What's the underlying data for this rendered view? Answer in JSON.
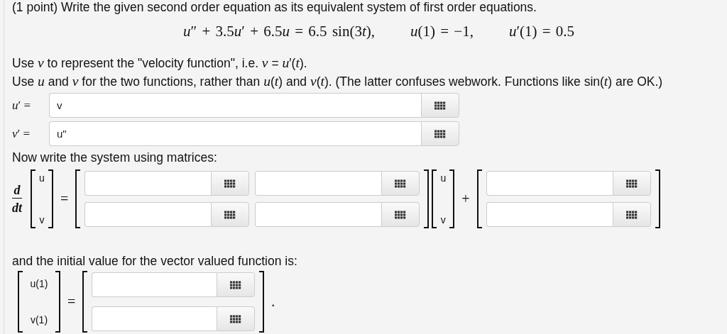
{
  "problem": {
    "intro": "(1 point) Write the given second order equation as its equivalent system of first order equations.",
    "equation": [
      "u″ + 3.5u′ + 6.5u = 6.5 sin(3t),",
      "u(1) = −1,",
      "u′(1) = 0.5"
    ],
    "notes": [
      "Use *v* to represent the \"velocity function\", i.e. *v* = *u*′(*t*).",
      "Use *u* and *v* for the two functions, rather than *u*(*t*) and *v*(*t*). (The latter confuses webwork. Functions like sin(*t*) are OK.)"
    ],
    "first_order": [
      {
        "label": "*u*′ =",
        "value": "v"
      },
      {
        "label": "*v*′ =",
        "value": "u\""
      }
    ],
    "matrix_prompt": "Now write the system using matrices:",
    "derivative": {
      "numerator": "d",
      "denominator": "dt"
    },
    "lhs_vector": [
      "u",
      "v"
    ],
    "equals": "=",
    "coefficient_matrix": [
      [
        {
          "kind": "field"
        },
        {
          "kind": "field"
        }
      ],
      [
        {
          "kind": "field"
        },
        {
          "kind": "field"
        }
      ]
    ],
    "state_vector": [
      "u",
      "v"
    ],
    "plus": "+",
    "forcing_vector": [
      {
        "kind": "field"
      },
      {
        "kind": "field"
      }
    ],
    "initial_prompt": "and the initial value for the vector valued function is:",
    "initial_lhs": [
      "u(1)",
      "v(1)"
    ],
    "initial_equals": "=",
    "initial_rhs": [
      {
        "kind": "field"
      },
      {
        "kind": "field"
      }
    ],
    "initial_end": "."
  }
}
